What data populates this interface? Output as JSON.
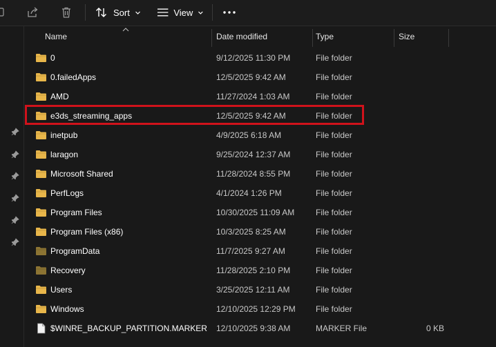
{
  "toolbar": {
    "sort_label": "Sort",
    "view_label": "View",
    "more_label": "•••"
  },
  "columns": {
    "name": "Name",
    "date_modified": "Date modified",
    "type": "Type",
    "size": "Size"
  },
  "rows": [
    {
      "name": "0",
      "date": "9/12/2025 11:30 PM",
      "type": "File folder",
      "size": "",
      "icon": "folder-icon"
    },
    {
      "name": "0.failedApps",
      "date": "12/5/2025 9:42 AM",
      "type": "File folder",
      "size": "",
      "icon": "folder-icon"
    },
    {
      "name": "AMD",
      "date": "11/27/2024 1:03 AM",
      "type": "File folder",
      "size": "",
      "icon": "folder-icon"
    },
    {
      "name": "e3ds_streaming_apps",
      "date": "12/5/2025 9:42 AM",
      "type": "File folder",
      "size": "",
      "icon": "folder-icon"
    },
    {
      "name": "inetpub",
      "date": "4/9/2025 6:18 AM",
      "type": "File folder",
      "size": "",
      "icon": "folder-icon"
    },
    {
      "name": "laragon",
      "date": "9/25/2024 12:37 AM",
      "type": "File folder",
      "size": "",
      "icon": "folder-icon"
    },
    {
      "name": "Microsoft Shared",
      "date": "11/28/2024 8:55 PM",
      "type": "File folder",
      "size": "",
      "icon": "folder-icon"
    },
    {
      "name": "PerfLogs",
      "date": "4/1/2024 1:26 PM",
      "type": "File folder",
      "size": "",
      "icon": "folder-icon"
    },
    {
      "name": "Program Files",
      "date": "10/30/2025 11:09 AM",
      "type": "File folder",
      "size": "",
      "icon": "folder-icon"
    },
    {
      "name": "Program Files (x86)",
      "date": "10/3/2025 8:25 AM",
      "type": "File folder",
      "size": "",
      "icon": "folder-icon"
    },
    {
      "name": "ProgramData",
      "date": "11/7/2025 9:27 AM",
      "type": "File folder",
      "size": "",
      "icon": "hidden-folder-icon"
    },
    {
      "name": "Recovery",
      "date": "11/28/2025 2:10 PM",
      "type": "File folder",
      "size": "",
      "icon": "hidden-folder-icon"
    },
    {
      "name": "Users",
      "date": "3/25/2025 12:11 AM",
      "type": "File folder",
      "size": "",
      "icon": "folder-icon"
    },
    {
      "name": "Windows",
      "date": "12/10/2025 12:29 PM",
      "type": "File folder",
      "size": "",
      "icon": "folder-icon"
    },
    {
      "name": "$WINRE_BACKUP_PARTITION.MARKER",
      "date": "12/10/2025 9:38 AM",
      "type": "MARKER File",
      "size": "0 KB",
      "icon": "file-icon"
    }
  ],
  "highlighted_row": "e3ds_streaming_apps",
  "colors": {
    "background": "#191919",
    "folder": "#e8b64a",
    "hidden_folder": "#8c7433",
    "highlight_border": "#d0121b"
  }
}
